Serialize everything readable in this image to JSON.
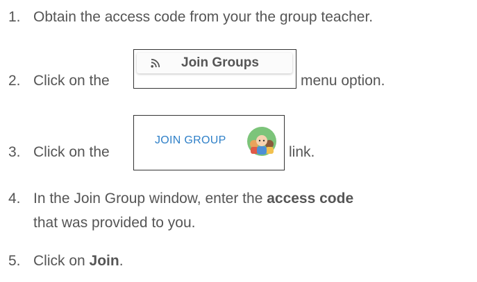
{
  "steps": [
    {
      "num": "1.",
      "text": "Obtain the access code from your the group teacher."
    },
    {
      "num": "2.",
      "pre": "Click on the",
      "post": "menu option."
    },
    {
      "num": "3.",
      "pre": "Click on the",
      "post": "link."
    },
    {
      "num": "4.",
      "pre": "In the Join Group window, enter the",
      "bold": "access code",
      "line2": "that was provided to you."
    },
    {
      "num": "5.",
      "pre": "Click on",
      "bold": "Join",
      "post": "."
    }
  ],
  "join_groups_menu": {
    "label": "Join Groups",
    "icon": "rss-icon"
  },
  "join_group_link": {
    "label": "JOIN GROUP",
    "icon": "group-avatar-icon"
  },
  "colors": {
    "text": "#555555",
    "link": "#2f80c8",
    "border": "#333333"
  }
}
